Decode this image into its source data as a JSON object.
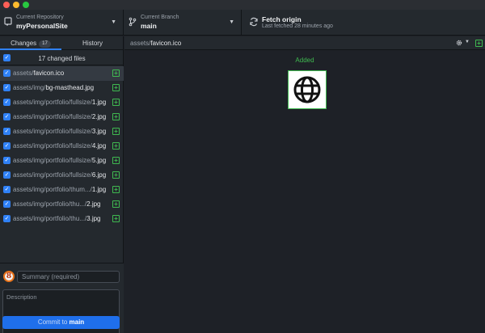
{
  "window": {
    "controls": [
      "close",
      "minimize",
      "zoom"
    ]
  },
  "toolbar": {
    "repo": {
      "caption": "Current Repository",
      "value": "myPersonalSite",
      "icon": "repo-icon"
    },
    "branch": {
      "caption": "Current Branch",
      "value": "main",
      "icon": "branch-icon"
    },
    "fetch": {
      "title": "Fetch origin",
      "subtitle": "Last fetched 28 minutes ago",
      "icon": "sync-icon"
    }
  },
  "sidebar": {
    "tabs": [
      {
        "label": "Changes",
        "badge": "17",
        "active": true
      },
      {
        "label": "History",
        "active": false
      }
    ],
    "changed_files_label": "17 changed files",
    "files": [
      {
        "dir": "assets/",
        "name": "favicon.ico",
        "checked": true,
        "selected": true,
        "status": "added"
      },
      {
        "dir": "assets/img/",
        "name": "bg-masthead.jpg",
        "checked": true,
        "status": "added"
      },
      {
        "dir": "assets/img/portfolio/fullsize/",
        "name": "1.jpg",
        "checked": true,
        "status": "added"
      },
      {
        "dir": "assets/img/portfolio/fullsize/",
        "name": "2.jpg",
        "checked": true,
        "status": "added"
      },
      {
        "dir": "assets/img/portfolio/fullsize/",
        "name": "3.jpg",
        "checked": true,
        "status": "added"
      },
      {
        "dir": "assets/img/portfolio/fullsize/",
        "name": "4.jpg",
        "checked": true,
        "status": "added"
      },
      {
        "dir": "assets/img/portfolio/fullsize/",
        "name": "5.jpg",
        "checked": true,
        "status": "added"
      },
      {
        "dir": "assets/img/portfolio/fullsize/",
        "name": "6.jpg",
        "checked": true,
        "status": "added"
      },
      {
        "dir": "assets/img/portfolio/thum.../",
        "name": "1.jpg",
        "checked": true,
        "status": "added"
      },
      {
        "dir": "assets/img/portfolio/thu.../",
        "name": "2.jpg",
        "checked": true,
        "status": "added"
      },
      {
        "dir": "assets/img/portfolio/thu.../",
        "name": "3.jpg",
        "checked": true,
        "status": "added"
      }
    ],
    "commit": {
      "avatar_letter": "8",
      "summary_placeholder": "Summary (required)",
      "description_placeholder": "Description",
      "button_prefix": "Commit to ",
      "button_branch": "main"
    }
  },
  "diff": {
    "dir": "assets/",
    "name": "favicon.ico",
    "status_label": "Added",
    "preview_icon": "globe-icon"
  },
  "colors": {
    "accent": "#2f81f7",
    "added": "#3fb950",
    "commit_button": "#1f6feb",
    "background": "#1e2127",
    "panel": "#24292e"
  }
}
